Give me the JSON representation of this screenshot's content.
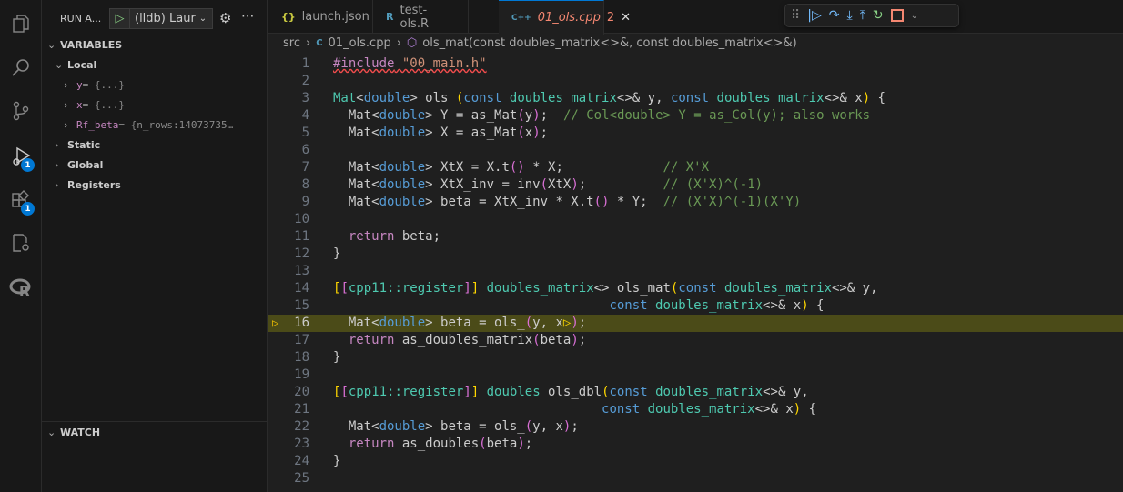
{
  "activity": {
    "debug_badge": "1",
    "extensions_badge": "1"
  },
  "sidebar": {
    "title": "RUN A...",
    "launch_config": "(lldb) Laur",
    "variables_header": "VARIABLES",
    "local": "Local",
    "vars": [
      {
        "name": "y",
        "value": " = {...}"
      },
      {
        "name": "x",
        "value": " = {...}"
      },
      {
        "name": "Rf_beta",
        "value": " = {n_rows:14073735…"
      }
    ],
    "static": "Static",
    "global": "Global",
    "registers": "Registers",
    "watch_header": "WATCH"
  },
  "tabs": [
    {
      "label": "launch.json",
      "icon": "{}"
    },
    {
      "label": "test-ols.R",
      "icon": "R"
    },
    {
      "label": "01_ols.cpp",
      "problems": "2",
      "icon": "C++"
    }
  ],
  "breadcrumb": {
    "folder": "src",
    "file": "01_ols.cpp",
    "symbol": "ols_mat(const doubles_matrix<>&, const doubles_matrix<>&)"
  },
  "editor": {
    "current_line": 16,
    "lines": [
      [
        [
          "#include",
          "r sq"
        ],
        [
          " \"00_main.h\"",
          "s sq"
        ]
      ],
      [],
      [
        [
          "Mat",
          "t"
        ],
        [
          "<",
          "p"
        ],
        [
          "double",
          "k"
        ],
        [
          "> ols_",
          "p"
        ],
        [
          "(",
          "y"
        ],
        [
          "const ",
          "k"
        ],
        [
          "doubles_matrix",
          "t"
        ],
        [
          "<>& y, ",
          "p"
        ],
        [
          "const ",
          "k"
        ],
        [
          "doubles_matrix",
          "t"
        ],
        [
          "<>& x",
          "p"
        ],
        [
          ")",
          "y"
        ],
        [
          " {",
          "p"
        ]
      ],
      [
        [
          "  Mat",
          "p"
        ],
        [
          "<",
          "p"
        ],
        [
          "double",
          "k"
        ],
        [
          "> Y = as_Mat",
          "p"
        ],
        [
          "(",
          "m"
        ],
        [
          "y",
          "p"
        ],
        [
          ")",
          "m"
        ],
        [
          ";  ",
          "p"
        ],
        [
          "// Col<double> Y = as_Col(y); also works",
          "c"
        ]
      ],
      [
        [
          "  Mat<",
          "p"
        ],
        [
          "double",
          "k"
        ],
        [
          "> X = as_Mat",
          "p"
        ],
        [
          "(",
          "m"
        ],
        [
          "x",
          "p"
        ],
        [
          ")",
          "m"
        ],
        [
          ";",
          "p"
        ]
      ],
      [],
      [
        [
          "  Mat<",
          "p"
        ],
        [
          "double",
          "k"
        ],
        [
          "> XtX = X.t",
          "p"
        ],
        [
          "()",
          "m"
        ],
        [
          " * X;             ",
          "p"
        ],
        [
          "// X'X",
          "c"
        ]
      ],
      [
        [
          "  Mat<",
          "p"
        ],
        [
          "double",
          "k"
        ],
        [
          "> XtX_inv = inv",
          "p"
        ],
        [
          "(",
          "m"
        ],
        [
          "XtX",
          "p"
        ],
        [
          ")",
          "m"
        ],
        [
          ";          ",
          "p"
        ],
        [
          "// (X'X)^(-1)",
          "c"
        ]
      ],
      [
        [
          "  Mat<",
          "p"
        ],
        [
          "double",
          "k"
        ],
        [
          "> beta = XtX_inv * X.t",
          "p"
        ],
        [
          "()",
          "m"
        ],
        [
          " * Y;  ",
          "p"
        ],
        [
          "// (X'X)^(-1)(X'Y)",
          "c"
        ]
      ],
      [],
      [
        [
          "  ",
          "p"
        ],
        [
          "return",
          "r"
        ],
        [
          " beta;",
          "p"
        ]
      ],
      [
        [
          "}",
          "p"
        ]
      ],
      [],
      [
        [
          "[",
          "y"
        ],
        [
          "[",
          "m"
        ],
        [
          "cpp11::register",
          "t"
        ],
        [
          "]",
          "m"
        ],
        [
          "]",
          "y"
        ],
        [
          " doubles_matrix",
          "t"
        ],
        [
          "<> ols_mat",
          "p"
        ],
        [
          "(",
          "y"
        ],
        [
          "const ",
          "k"
        ],
        [
          "doubles_matrix",
          "t"
        ],
        [
          "<>& y,",
          "p"
        ]
      ],
      [
        [
          "                                    ",
          "p"
        ],
        [
          "const ",
          "k"
        ],
        [
          "doubles_matrix",
          "t"
        ],
        [
          "<>& x",
          "p"
        ],
        [
          ")",
          "y"
        ],
        [
          " {",
          "p"
        ]
      ],
      [
        [
          "  Mat<",
          "p"
        ],
        [
          "double",
          "k"
        ],
        [
          "> beta = ols_",
          "p"
        ],
        [
          "(",
          "m"
        ],
        [
          "y, x",
          "p"
        ],
        [
          "▷",
          "y"
        ],
        [
          ")",
          "m"
        ],
        [
          ";",
          "p"
        ]
      ],
      [
        [
          "  ",
          "p"
        ],
        [
          "return",
          "r"
        ],
        [
          " as_doubles_matrix",
          "p"
        ],
        [
          "(",
          "m"
        ],
        [
          "beta",
          "p"
        ],
        [
          ")",
          "m"
        ],
        [
          ";",
          "p"
        ]
      ],
      [
        [
          "}",
          "p"
        ]
      ],
      [],
      [
        [
          "[",
          "y"
        ],
        [
          "[",
          "m"
        ],
        [
          "cpp11::register",
          "t"
        ],
        [
          "]",
          "m"
        ],
        [
          "]",
          "y"
        ],
        [
          " doubles",
          "t"
        ],
        [
          " ols_dbl",
          "p"
        ],
        [
          "(",
          "y"
        ],
        [
          "const ",
          "k"
        ],
        [
          "doubles_matrix",
          "t"
        ],
        [
          "<>& y,",
          "p"
        ]
      ],
      [
        [
          "                                   ",
          "p"
        ],
        [
          "const ",
          "k"
        ],
        [
          "doubles_matrix",
          "t"
        ],
        [
          "<>& x",
          "p"
        ],
        [
          ")",
          "y"
        ],
        [
          " {",
          "p"
        ]
      ],
      [
        [
          "  Mat<",
          "p"
        ],
        [
          "double",
          "k"
        ],
        [
          "> beta = ols_",
          "p"
        ],
        [
          "(",
          "m"
        ],
        [
          "y, x",
          "p"
        ],
        [
          ")",
          "m"
        ],
        [
          ";",
          "p"
        ]
      ],
      [
        [
          "  ",
          "p"
        ],
        [
          "return",
          "r"
        ],
        [
          " as_doubles",
          "p"
        ],
        [
          "(",
          "m"
        ],
        [
          "beta",
          "p"
        ],
        [
          ")",
          "m"
        ],
        [
          ";",
          "p"
        ]
      ],
      [
        [
          "}",
          "p"
        ]
      ],
      []
    ]
  }
}
